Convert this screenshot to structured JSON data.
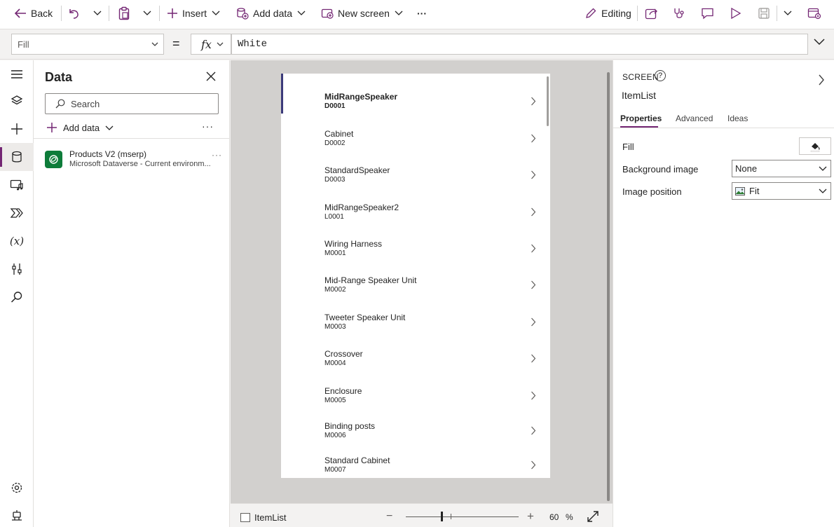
{
  "toolbar": {
    "back_label": "Back",
    "insert_label": "Insert",
    "add_data_label": "Add data",
    "new_screen_label": "New screen",
    "more_label": "···",
    "editing_label": "Editing"
  },
  "formula_bar": {
    "property": "Fill",
    "equals": "=",
    "fx_label": "fx",
    "formula": "White"
  },
  "left_rail": {
    "items": [
      "menu-icon",
      "tree-view-icon",
      "insert-icon",
      "data-icon",
      "media-icon",
      "power-automate-icon",
      "variables-icon",
      "advanced-tools-icon",
      "search-icon"
    ],
    "bottom_items": [
      "settings-icon",
      "virtual-agent-icon"
    ],
    "active": "data-icon"
  },
  "data_pane": {
    "title": "Data",
    "search_placeholder": "Search",
    "add_data_label": "Add data",
    "more_label": "···",
    "sources": [
      {
        "name": "Products V2 (mserp)",
        "subtitle": "Microsoft Dataverse - Current environm...",
        "more": "···"
      }
    ]
  },
  "gallery": {
    "items": [
      {
        "title": "MidRangeSpeaker",
        "subtitle": "D0001",
        "selected": true
      },
      {
        "title": "Cabinet",
        "subtitle": "D0002"
      },
      {
        "title": "StandardSpeaker",
        "subtitle": "D0003"
      },
      {
        "title": "MidRangeSpeaker2",
        "subtitle": "L0001"
      },
      {
        "title": "Wiring Harness",
        "subtitle": "M0001"
      },
      {
        "title": "Mid-Range Speaker Unit",
        "subtitle": "M0002"
      },
      {
        "title": "Tweeter Speaker Unit",
        "subtitle": "M0003"
      },
      {
        "title": "Crossover",
        "subtitle": "M0004"
      },
      {
        "title": "Enclosure",
        "subtitle": "M0005"
      },
      {
        "title": "Binding posts",
        "subtitle": "M0006"
      },
      {
        "title": "Standard Cabinet",
        "subtitle": "M0007"
      }
    ]
  },
  "status_bar": {
    "screen_name": "ItemList",
    "zoom_value": "60",
    "zoom_unit": "%",
    "minus": "−",
    "plus": "+"
  },
  "properties_pane": {
    "type_label": "SCREEN",
    "help_label": "?",
    "name": "ItemList",
    "tabs": [
      "Properties",
      "Advanced",
      "Ideas"
    ],
    "active_tab": "Properties",
    "fill_label": "Fill",
    "fill_color": "#ffffff",
    "background_image_label": "Background image",
    "background_image_value": "None",
    "image_position_label": "Image position",
    "image_position_value": "Fit"
  },
  "colors": {
    "accent": "#742774",
    "dataverse_green": "#0e7c3a",
    "canvas_bg": "#d2d0ce"
  }
}
